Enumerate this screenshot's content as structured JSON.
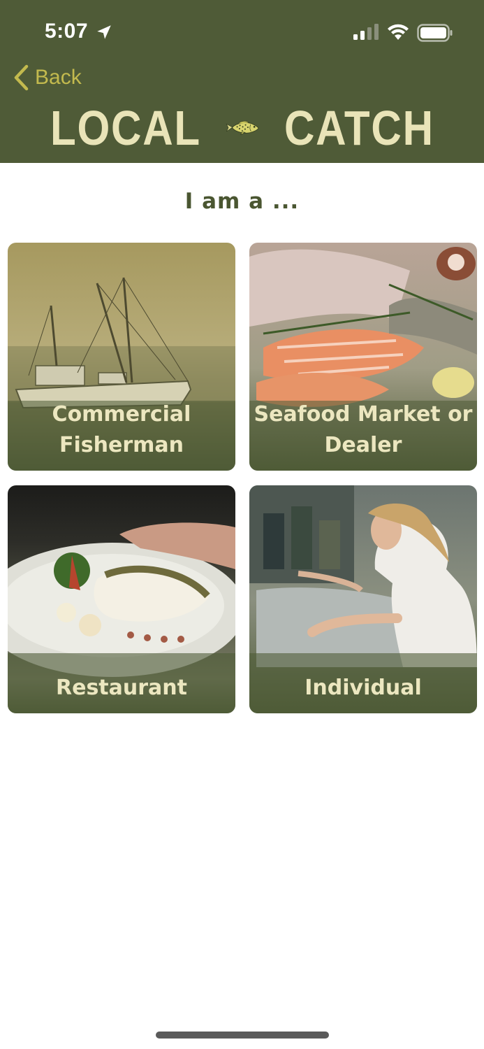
{
  "status_bar": {
    "time": "5:07",
    "icons": [
      "location-arrow-icon",
      "cellular-signal-icon",
      "wifi-icon",
      "battery-icon"
    ]
  },
  "nav": {
    "back_label": "Back",
    "back_icon": "chevron-left-icon"
  },
  "logo": {
    "left_word": "LOCAL",
    "right_word": "CATCH",
    "icon": "fish-icon"
  },
  "heading": "I am a ...",
  "options": [
    {
      "label_line1": "Commercial",
      "label_line2": "Fisherman",
      "image": "fishing-boat-image"
    },
    {
      "label_line1": "Seafood Market or",
      "label_line2": "Dealer",
      "image": "seafood-display-image"
    },
    {
      "label": "Restaurant",
      "image": "plated-fish-image"
    },
    {
      "label": "Individual",
      "image": "shopper-at-fish-counter-image"
    }
  ],
  "colors": {
    "header_bg": "#4f5b37",
    "accent": "#c3ba4e",
    "logo_text": "#e9e4b8",
    "heading_text": "#4a5631",
    "card_overlay": "#4f5b37"
  }
}
